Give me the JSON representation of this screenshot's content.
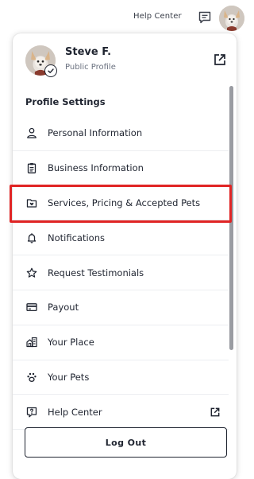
{
  "topbar": {
    "help_label": "Help Center",
    "message_icon": "message-icon",
    "avatar_icon": "dog-avatar"
  },
  "profile": {
    "name": "Steve F.",
    "subtitle": "Public Profile",
    "avatar_icon": "dog-avatar",
    "badge_icon": "verified-check-icon",
    "external_icon": "external-link-icon"
  },
  "section_title": "Profile Settings",
  "menu": {
    "items": [
      {
        "label": "Personal Information",
        "icon": "person-icon"
      },
      {
        "label": "Business Information",
        "icon": "clipboard-icon"
      },
      {
        "label": "Services, Pricing & Accepted Pets",
        "icon": "folder-heart-icon"
      },
      {
        "label": "Notifications",
        "icon": "bell-icon"
      },
      {
        "label": "Request Testimonials",
        "icon": "star-icon"
      },
      {
        "label": "Payout",
        "icon": "credit-card-icon"
      },
      {
        "label": "Your Place",
        "icon": "house-icon"
      },
      {
        "label": "Your Pets",
        "icon": "paw-icon"
      },
      {
        "label": "Help Center",
        "icon": "help-chat-icon",
        "trailing_icon": "external-link-icon"
      }
    ]
  },
  "logout_label": "Log Out",
  "colors": {
    "highlight": "#e02424",
    "text": "#1f2430",
    "muted": "#6b7280"
  }
}
